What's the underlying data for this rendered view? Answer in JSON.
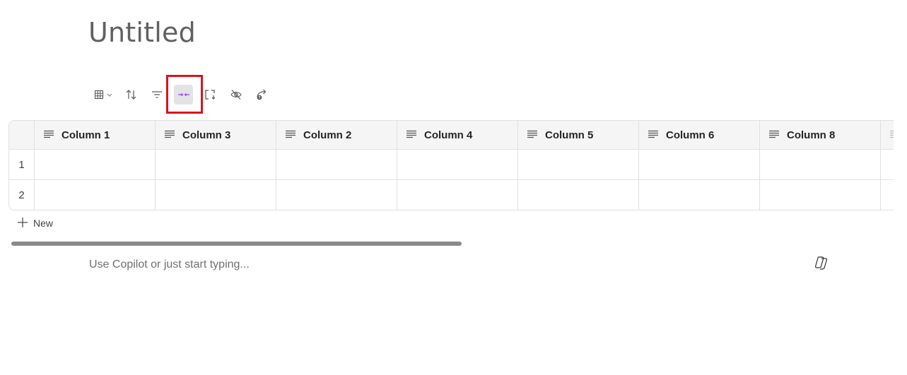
{
  "page": {
    "title": "Untitled"
  },
  "toolbar": {
    "buttons": [
      {
        "name": "table-view-icon",
        "label": "Table view"
      },
      {
        "name": "sort-icon",
        "label": "Sort"
      },
      {
        "name": "filter-icon",
        "label": "Filter"
      },
      {
        "name": "collapse-columns-icon",
        "label": "Collapse",
        "active": true
      },
      {
        "name": "resize-icon",
        "label": "Resize"
      },
      {
        "name": "hide-icon",
        "label": "Hide"
      },
      {
        "name": "share-icon",
        "label": "Share"
      }
    ],
    "accent_color": "#8a3ffc",
    "highlight_color": "#d9141b"
  },
  "table": {
    "columns": [
      "Column 1",
      "Column 3",
      "Column 2",
      "Column 4",
      "Column 5",
      "Column 6",
      "Column 8"
    ],
    "rows": [
      {
        "number": "1",
        "cells": [
          "",
          "",
          "",
          "",
          "",
          "",
          ""
        ]
      },
      {
        "number": "2",
        "cells": [
          "",
          "",
          "",
          "",
          "",
          "",
          ""
        ]
      }
    ],
    "column_icon": "text-lines-icon"
  },
  "new_row": {
    "label": "New"
  },
  "editor": {
    "placeholder": "Use Copilot or just start typing..."
  },
  "copilot": {
    "icon": "copilot-icon"
  }
}
